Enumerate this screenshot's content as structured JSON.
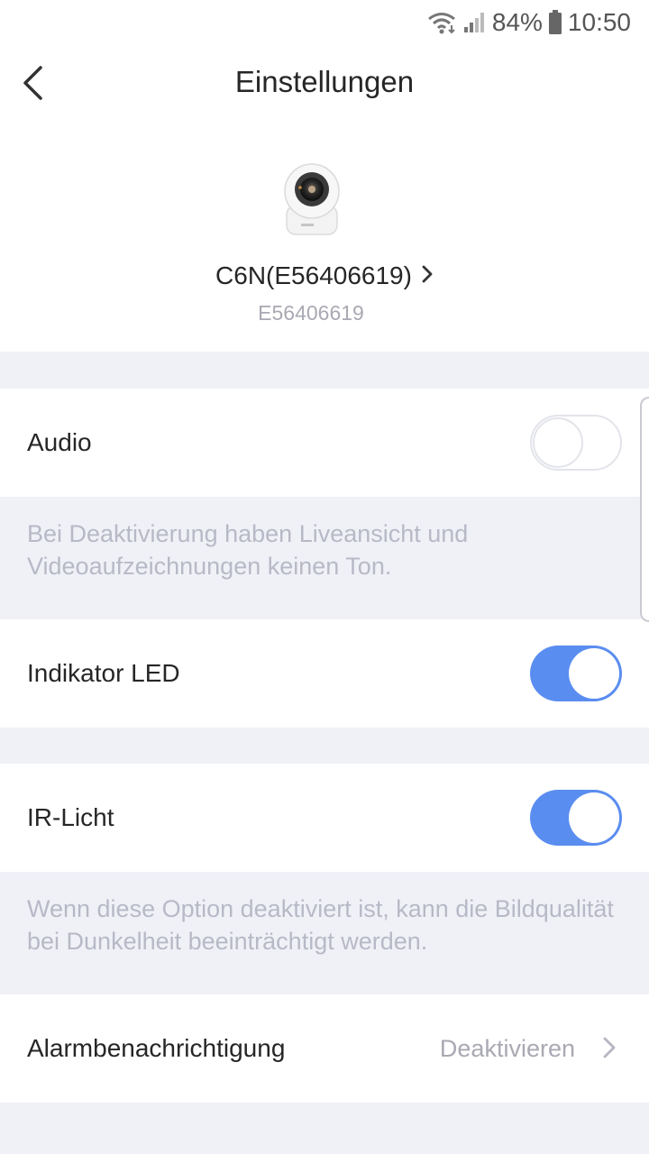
{
  "status_bar": {
    "battery": "84%",
    "time": "10:50"
  },
  "header": {
    "title": "Einstellungen",
    "back_icon": "chevron-left-icon"
  },
  "device": {
    "name": "C6N(E56406619)",
    "serial": "E56406619",
    "image_icon": "camera-icon"
  },
  "settings": {
    "audio": {
      "label": "Audio",
      "enabled": false,
      "note": "Bei Deaktivierung haben Liveansicht und Videoaufzeichnungen keinen Ton."
    },
    "led": {
      "label": "Indikator LED",
      "enabled": true
    },
    "ir": {
      "label": "IR-Licht",
      "enabled": true,
      "note": "Wenn diese Option deaktiviert ist, kann die Bildqualität bei Dunkelheit beeinträchtigt werden."
    },
    "alarm": {
      "label": "Alarmbenachrichtigung",
      "value": "Deaktivieren"
    }
  },
  "colors": {
    "accent": "#5a8df0",
    "background": "#f0f1f7",
    "note_text": "#b7b9c6"
  }
}
